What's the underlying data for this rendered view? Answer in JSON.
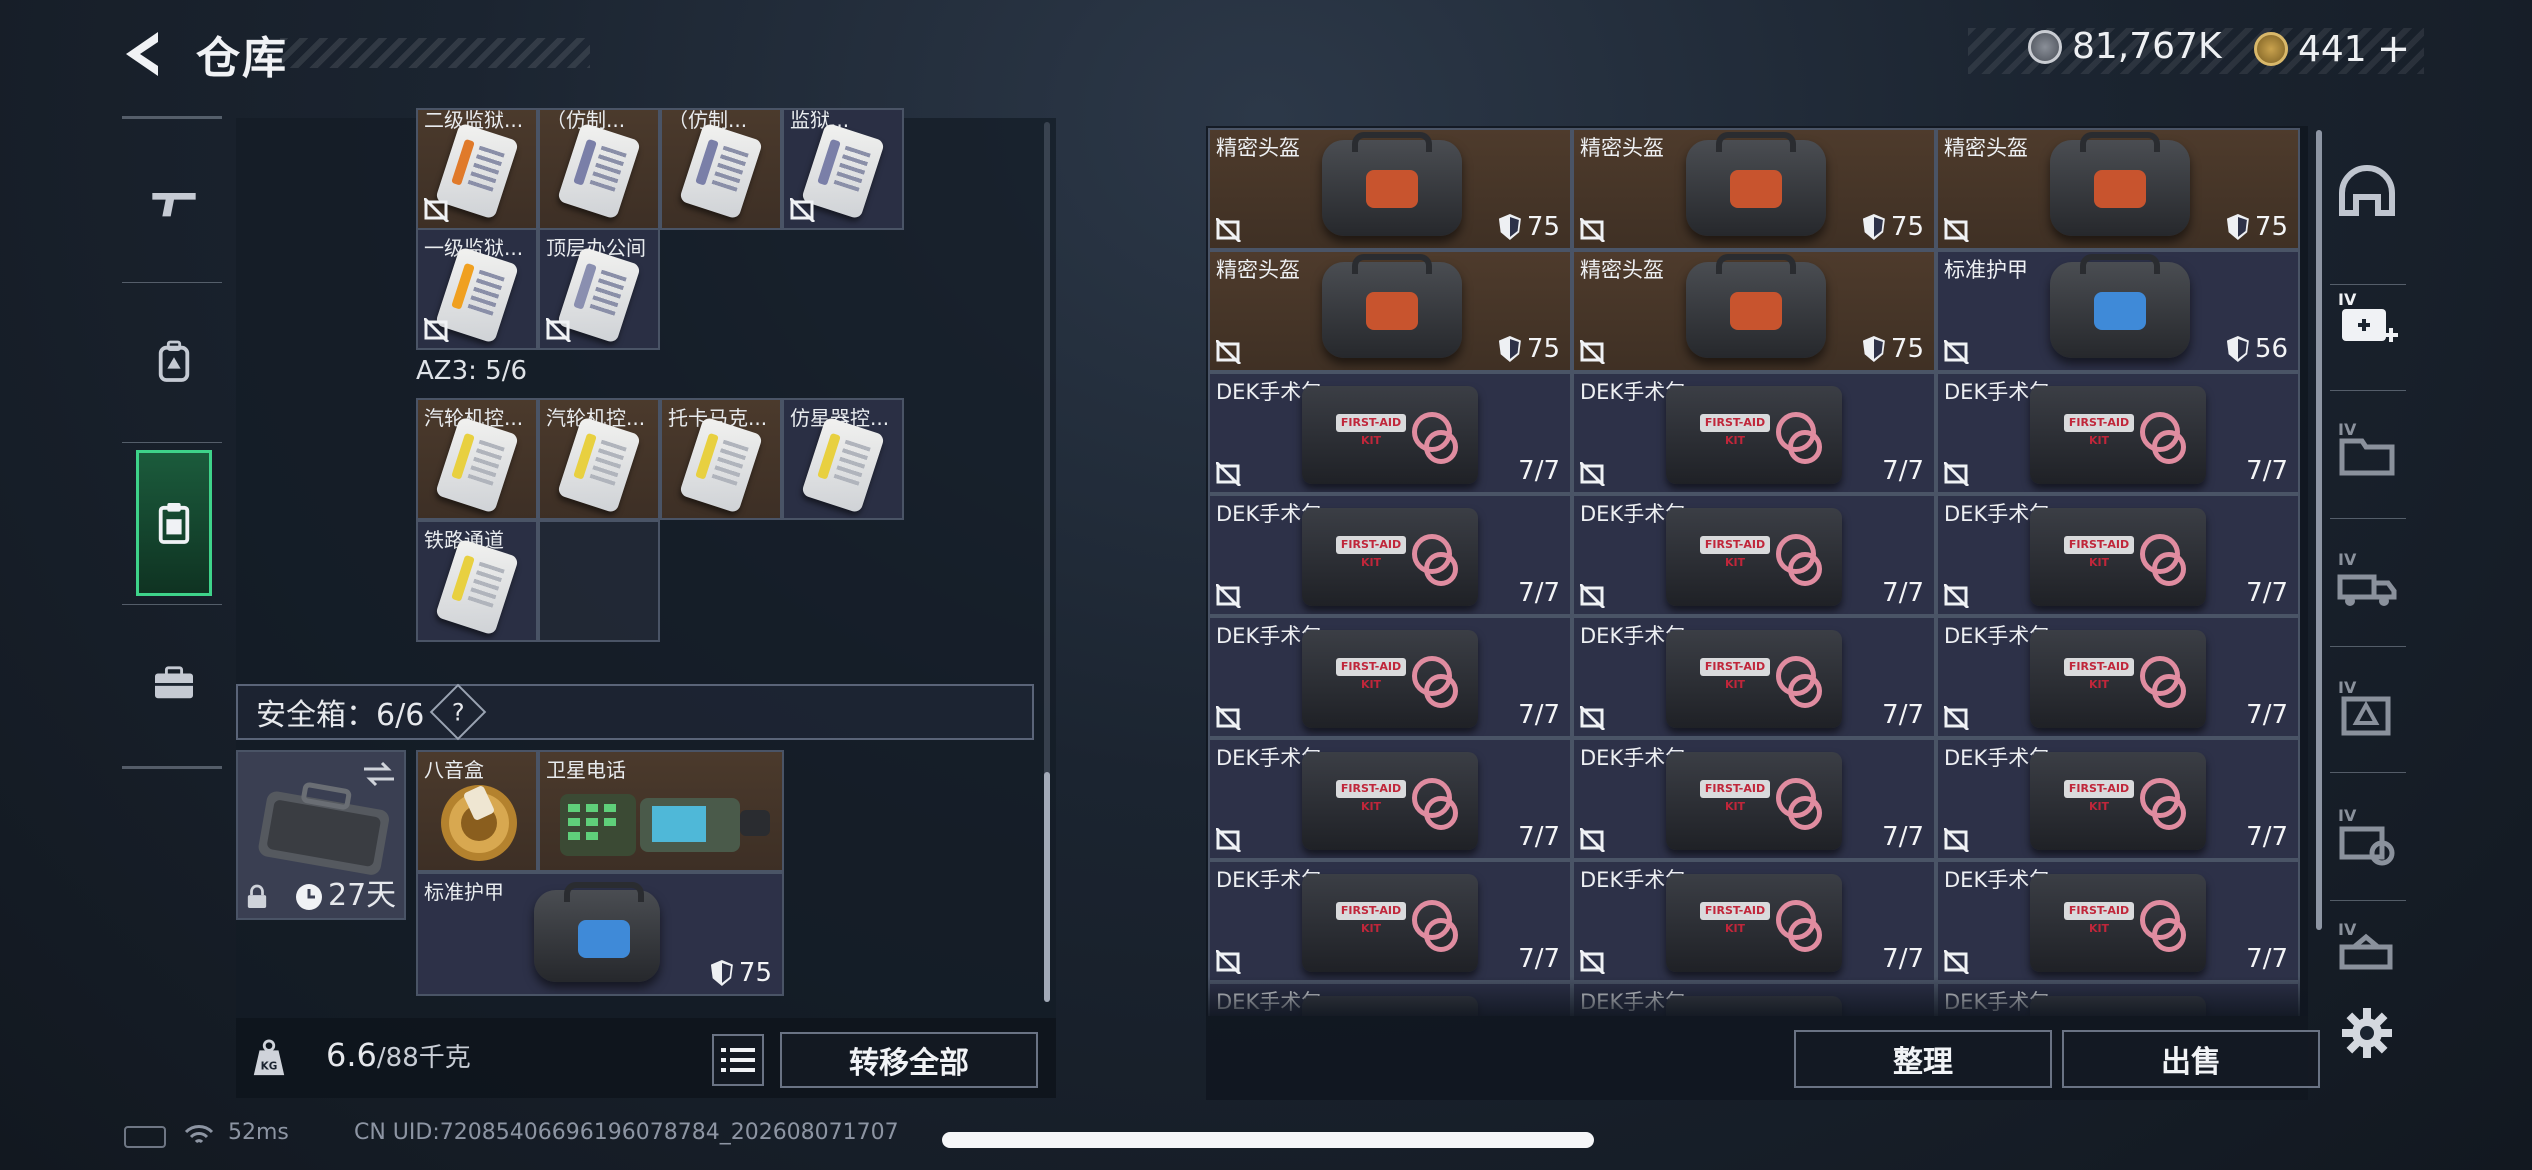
{
  "header": {
    "title": "仓库",
    "currency_silver": "81,767K",
    "currency_gold": "441",
    "gold_add": "+"
  },
  "left_rail": {
    "items": [
      {
        "name": "weapons",
        "icon": "gun-icon"
      },
      {
        "name": "equipment",
        "icon": "backpack-icon"
      },
      {
        "name": "storage",
        "icon": "clipboard-icon",
        "active": true
      },
      {
        "name": "tools",
        "icon": "briefcase-icon"
      }
    ]
  },
  "key_grid": {
    "row1": [
      {
        "name": "二级监狱...",
        "stripe": "#e07a2a",
        "locked": true
      },
      {
        "name": "（仿制...",
        "stripe": "#7a7fa8",
        "locked": false
      },
      {
        "name": "（仿制...",
        "stripe": "#7a7fa8",
        "locked": false
      },
      {
        "name": "监狱...",
        "stripe": "#7a7fa8",
        "locked": true
      }
    ],
    "row2": [
      {
        "name": "一级监狱...",
        "stripe": "#f0a020",
        "locked": true
      },
      {
        "name": "顶层办公间",
        "stripe": "#8a8fb0",
        "locked": true
      }
    ]
  },
  "az3": {
    "label": "AZ3: 5/6",
    "row1": [
      {
        "name": "汽轮机控...",
        "stripe": "#e8d040"
      },
      {
        "name": "汽轮机控...",
        "stripe": "#e8d040"
      },
      {
        "name": "托卡马克...",
        "stripe": "#e8d040"
      },
      {
        "name": "仿星器控...",
        "stripe": "#e8d040"
      }
    ],
    "row2": [
      {
        "name": "铁路通道",
        "stripe": "#e8d040"
      }
    ]
  },
  "safe_box": {
    "label": "安全箱：6/6",
    "help": "?",
    "days": "27天",
    "items": [
      {
        "name": "八音盒"
      },
      {
        "name": "卫星电话"
      },
      {
        "name": "标准护甲",
        "value": "75"
      }
    ]
  },
  "weight": {
    "current": "6.6",
    "max": "/88千克",
    "kg_badge": "KG",
    "transfer_all": "转移全部"
  },
  "inventory": {
    "rows": [
      [
        {
          "name": "精密头盔",
          "type": "helmet",
          "value": "75"
        },
        {
          "name": "精密头盔",
          "type": "helmet",
          "value": "75"
        },
        {
          "name": "精密头盔",
          "type": "helmet",
          "value": "75"
        }
      ],
      [
        {
          "name": "精密头盔",
          "type": "helmet",
          "value": "75"
        },
        {
          "name": "精密头盔",
          "type": "helmet",
          "value": "75"
        },
        {
          "name": "标准护甲",
          "type": "armor",
          "value": "56"
        }
      ],
      [
        {
          "name": "DEK手术包",
          "type": "kit",
          "value": "7/7"
        },
        {
          "name": "DEK手术包",
          "type": "kit",
          "value": "7/7"
        },
        {
          "name": "DEK手术包",
          "type": "kit",
          "value": "7/7"
        }
      ],
      [
        {
          "name": "DEK手术包",
          "type": "kit",
          "value": "7/7"
        },
        {
          "name": "DEK手术包",
          "type": "kit",
          "value": "7/7"
        },
        {
          "name": "DEK手术包",
          "type": "kit",
          "value": "7/7"
        }
      ],
      [
        {
          "name": "DEK手术包",
          "type": "kit",
          "value": "7/7"
        },
        {
          "name": "DEK手术包",
          "type": "kit",
          "value": "7/7"
        },
        {
          "name": "DEK手术包",
          "type": "kit",
          "value": "7/7"
        }
      ],
      [
        {
          "name": "DEK手术包",
          "type": "kit",
          "value": "7/7"
        },
        {
          "name": "DEK手术包",
          "type": "kit",
          "value": "7/7"
        },
        {
          "name": "DEK手术包",
          "type": "kit",
          "value": "7/7"
        }
      ],
      [
        {
          "name": "DEK手术包",
          "type": "kit",
          "value": "7/7"
        },
        {
          "name": "DEK手术包",
          "type": "kit",
          "value": "7/7"
        },
        {
          "name": "DEK手术包",
          "type": "kit",
          "value": "7/7"
        }
      ],
      [
        {
          "name": "DEK手术包",
          "type": "kit",
          "value": ""
        },
        {
          "name": "DEK手术包",
          "type": "kit",
          "value": ""
        },
        {
          "name": "DEK手术包",
          "type": "kit",
          "value": ""
        }
      ]
    ],
    "kit_tag": "FIRST-AID KIT",
    "sort_label": "整理",
    "sell_label": "出售"
  },
  "right_rail": {
    "tier_label": "IV",
    "items": [
      "helmet-icon",
      "medkit-add-icon",
      "folder-icon",
      "truck-icon",
      "box-icon",
      "gear-crate-icon",
      "crate-icon"
    ]
  },
  "status": {
    "ping": "52ms",
    "uid": "CN UID:7208540669619607​8784_202608071707"
  },
  "colors": {
    "accent_green": "#3ed38a",
    "helmet_bg": "#4e3b2c",
    "item_bg": "#2d3148",
    "armor_patch": "#3f8ad8",
    "helmet_patch": "#c8542e"
  }
}
